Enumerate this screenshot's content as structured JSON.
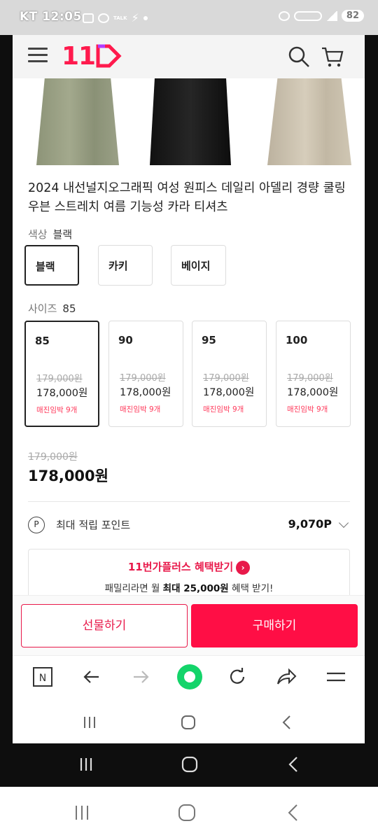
{
  "status_bar": {
    "time": "KT 12:05",
    "notif_label": "TALK",
    "battery": "82"
  },
  "header": {
    "logo": "11",
    "menu_icon": "hamburger-icon",
    "search_icon": "search-icon",
    "cart_icon": "cart-icon"
  },
  "product": {
    "title": "2024 내선널지오그래픽 여성 원피스 데일리 아델리 경량 쿨링 우븐 스트레치 여름 기능성 카라 티셔츠",
    "color_images": [
      "khaki",
      "black",
      "beige"
    ]
  },
  "color": {
    "label": "색상",
    "selected": "블랙",
    "options": [
      "블랙",
      "카키",
      "베이지"
    ]
  },
  "size": {
    "label": "사이즈",
    "selected": "85",
    "options": [
      {
        "size": "85",
        "orig": "179,000원",
        "price": "178,000원",
        "stock": "매진임박 9개"
      },
      {
        "size": "90",
        "orig": "179,000원",
        "price": "178,000원",
        "stock": "매진임박 9개"
      },
      {
        "size": "95",
        "orig": "179,000원",
        "price": "178,000원",
        "stock": "매진임박 9개"
      },
      {
        "size": "100",
        "orig": "179,000원",
        "price": "178,000원",
        "stock": "매진임박 9개"
      }
    ]
  },
  "price": {
    "original": "179,000원",
    "final": "178,000원"
  },
  "points": {
    "icon_letter": "P",
    "label": "최대 적립 포인트",
    "value": "9,070P"
  },
  "promo": {
    "title": "11번가플러스 혜택받기",
    "arrow": "›",
    "sub_prefix": "패밀리라면 월 ",
    "sub_bold": "최대 25,000원",
    "sub_suffix": " 혜택 받기!"
  },
  "actions": {
    "gift": "선물하기",
    "buy": "구매하기"
  },
  "browser_bar": {
    "n_label": "N"
  },
  "colors": {
    "brand": "#ff0e45",
    "brand_text": "#e8194a",
    "stock": "#ff3b5c"
  }
}
